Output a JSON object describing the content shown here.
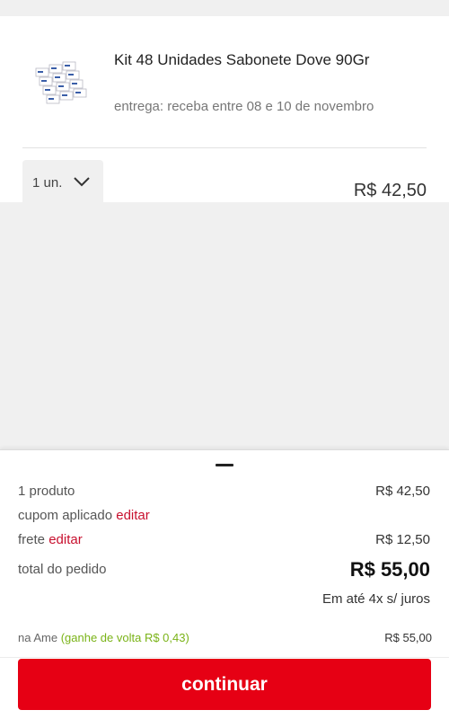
{
  "product": {
    "title": "Kit 48 Unidades Sabonete Dove 90Gr",
    "delivery": "entrega: receba entre 08 e 10 de novembro",
    "quantity": "1 un.",
    "price": "R$ 42,50",
    "thumbnail_icon": "soap-box-image"
  },
  "summary": {
    "products_label": "1 produto",
    "products_value": "R$ 42,50",
    "coupon_label": "cupom aplicado",
    "coupon_edit": "editar",
    "shipping_label": "frete",
    "shipping_edit": "editar",
    "shipping_value": "R$ 12,50",
    "total_label": "total do pedido",
    "total_value": "R$ 55,00",
    "installments": "Em até 4x s/ juros",
    "ame_label": "na Ame",
    "ame_cashback": "(ganhe de volta R$ 0,43)",
    "ame_value": "R$ 55,00"
  },
  "actions": {
    "continue_label": "continuar"
  },
  "colors": {
    "accent_red": "#e60014",
    "link_red": "#c8102e",
    "ame_green": "#7ab317"
  }
}
